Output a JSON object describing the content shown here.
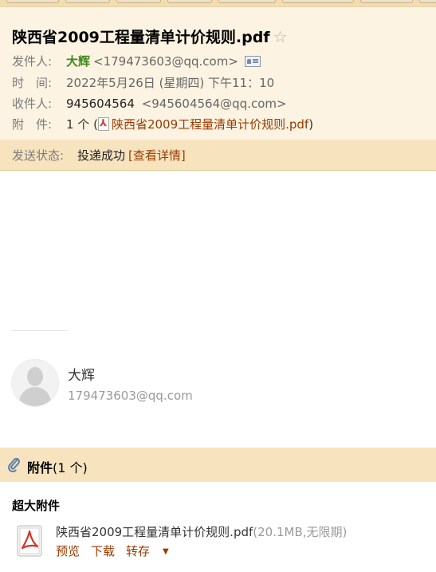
{
  "email": {
    "subject": "陕西省2009工程量清单计价规则.pdf",
    "star_icon": "☆",
    "from_label": "发件人:",
    "from_name": "大辉",
    "from_addr": "<179473603@qq.com>",
    "time_label": "时　间:",
    "time_value": "2022年5月26日 (星期四) 下午11：10",
    "to_label": "收件人:",
    "to_name": "945604564",
    "to_addr": "<945604564@qq.com>",
    "attach_label": "附　件:",
    "attach_count": "1 个 (",
    "attach_name": "陕西省2009工程量清单计价规则.pdf",
    "attach_close": ")",
    "status_label": "发送状态:",
    "status_value": "投递成功",
    "status_detail": "[查看详情]"
  },
  "signature": {
    "name": "大辉",
    "email": "179473603@qq.com"
  },
  "attachments": {
    "header_bold": "附件",
    "header_count": "(1 个)",
    "big_label": "超大附件",
    "file_name": "陕西省2009工程量清单计价规则.pdf",
    "file_meta": "(20.1MB,无限期)",
    "preview": "预览",
    "download": "下载",
    "save": "转存"
  },
  "colors": {
    "header_bg": "#fdf3e2",
    "status_bg": "#f7e4bf",
    "sender_green": "#3e8a1b",
    "link_brown": "#9b3a00"
  }
}
